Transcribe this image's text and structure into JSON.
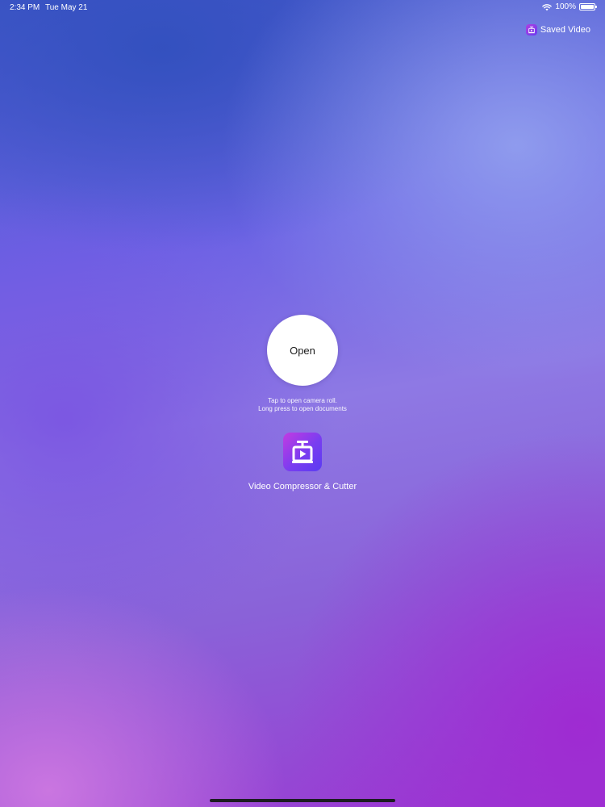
{
  "status_bar": {
    "time": "2:34 PM",
    "date": "Tue May 21",
    "battery": "100%",
    "battery_level": 1.0,
    "wifi_icon": "wifi-icon",
    "battery_icon": "battery-icon"
  },
  "header": {
    "saved_video_label": "Saved Video",
    "saved_video_icon": "compressor-app-icon"
  },
  "main": {
    "open_label": "Open",
    "hint_line1": "Tap to open camera roll.",
    "hint_line2": "Long press to open documents",
    "app_icon": "video-compressor-icon",
    "app_name": "Video Compressor & Cutter"
  },
  "colors": {
    "accent_gradient_start": "#c23be2",
    "accent_gradient_end": "#5a3cf2",
    "button_background": "#ffffff"
  }
}
